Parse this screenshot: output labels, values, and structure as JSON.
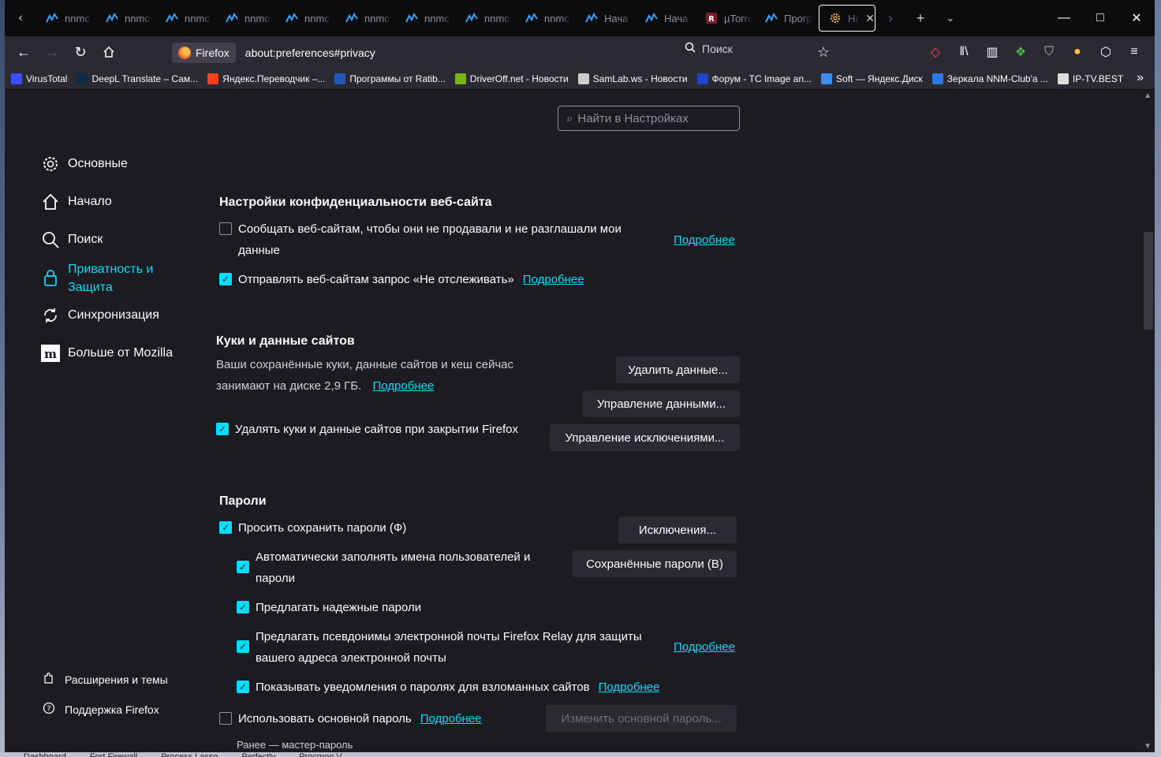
{
  "colors": {
    "accent": "#00ddff",
    "page_bg": "#1c1b22",
    "toolbar_bg": "#2b2a33",
    "tabstrip_bg": "#0c0c0d"
  },
  "tabs": [
    {
      "title": "nnmc",
      "icon": "nnm-club-icon"
    },
    {
      "title": "nnmc",
      "icon": "nnm-club-icon"
    },
    {
      "title": "nnmc",
      "icon": "nnm-club-icon"
    },
    {
      "title": "nnmc",
      "icon": "nnm-club-icon"
    },
    {
      "title": "nnmc",
      "icon": "nnm-club-icon"
    },
    {
      "title": "nnmc",
      "icon": "nnm-club-icon"
    },
    {
      "title": "nnmc",
      "icon": "nnm-club-icon"
    },
    {
      "title": "nnmc",
      "icon": "nnm-club-icon"
    },
    {
      "title": "nnmc",
      "icon": "nnm-club-icon"
    },
    {
      "title": "Нача",
      "icon": "nnm-club-icon"
    },
    {
      "title": "Нача",
      "icon": "nnm-club-icon"
    },
    {
      "title": "µTorre",
      "icon": "r-icon"
    },
    {
      "title": "Прогр",
      "icon": "nnm-club-icon"
    }
  ],
  "active_tab": {
    "title": "На",
    "icon": "gear-icon"
  },
  "navbar": {
    "identity_label": "Firefox",
    "url": "about:preferences#privacy",
    "search_label": "Поиск"
  },
  "bookmarks": [
    {
      "label": "VirusTotal",
      "color": "#394eff"
    },
    {
      "label": "DeepL Translate – Сам...",
      "color": "#0f2b46"
    },
    {
      "label": "Яндекс.Переводчик –...",
      "color": "#fc3f1d"
    },
    {
      "label": "Программы от Ratib...",
      "color": "#1e5bb8"
    },
    {
      "label": "DriverOff.net - Новости",
      "color": "#7ab317"
    },
    {
      "label": "SamLab.ws - Новости",
      "color": "#cccccc"
    },
    {
      "label": "Форум - TC Image an...",
      "color": "#2244cc"
    },
    {
      "label": "Soft — Яндекс.Диск",
      "color": "#3a8ef6"
    },
    {
      "label": "Зеркала NNM-Club'a ...",
      "color": "#2c7be5"
    },
    {
      "label": "IP-TV.BEST",
      "color": "#dddddd"
    }
  ],
  "pref_search_placeholder": "Найти в Настройках",
  "sidebar": {
    "items": [
      {
        "label": "Основные",
        "icon": "gear-icon"
      },
      {
        "label": "Начало",
        "icon": "home-icon"
      },
      {
        "label": "Поиск",
        "icon": "search-icon"
      },
      {
        "label": "Приватность и Защита",
        "icon": "lock-icon"
      },
      {
        "label": "Синхронизация",
        "icon": "sync-icon"
      },
      {
        "label": "Больше от Mozilla",
        "icon": "mozilla-icon"
      }
    ],
    "extensions": "Расширения и темы",
    "support": "Поддержка Firefox"
  },
  "website_privacy": {
    "heading": "Настройки конфиденциальности веб-сайта",
    "gpc_label": "Сообщать веб-сайтам, чтобы они не продавали и не разглашали мои данные",
    "gpc_checked": false,
    "dnt_label": "Отправлять веб-сайтам запрос «Не отслеживать»",
    "dnt_checked": true,
    "learn_more": "Подробнее"
  },
  "cookies": {
    "heading": "Куки и данные сайтов",
    "desc": "Ваши сохранённые куки, данные сайтов и кеш сейчас занимают на диске 2,9 ГБ.",
    "learn_more": "Подробнее",
    "delete_on_close": "Удалять куки и данные сайтов при закрытии Firefox",
    "delete_on_close_checked": true,
    "clear_button": "Удалить данные...",
    "manage_button": "Управление данными...",
    "exceptions_button": "Управление исключениями..."
  },
  "passwords": {
    "heading": "Пароли",
    "ask_save": "Просить сохранить пароли (Ф)",
    "autofill": "Автоматически заполнять имена пользователей и пароли",
    "suggest_strong": "Предлагать надежные пароли",
    "relay": "Предлагать псевдонимы электронной почты Firefox Relay для защиты вашего адреса электронной почты",
    "breach_alerts": "Показывать уведомления о паролях для взломанных сайтов",
    "primary_password": "Использовать основной пароль",
    "primary_note": "Ранее — мастер-пароль",
    "learn_more": "Подробнее",
    "exceptions_button": "Исключения...",
    "saved_button": "Сохранённые пароли (В)",
    "change_primary_button": "Изменить основной пароль..."
  },
  "taskbar": [
    "Dashboard",
    "Fort Firewall",
    "Process Lasso",
    "Perfectly",
    "Procmon V..."
  ]
}
